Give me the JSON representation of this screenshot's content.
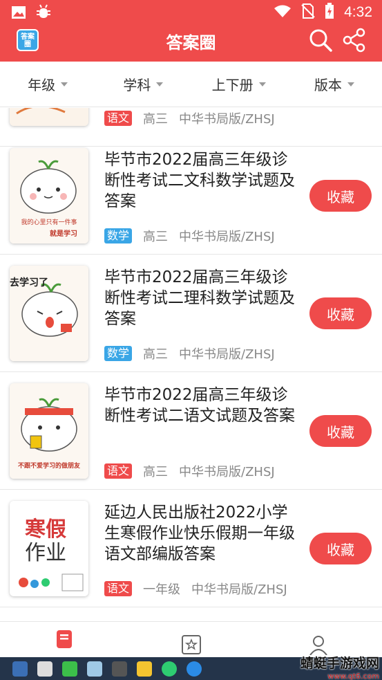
{
  "status_bar": {
    "time": "4:32"
  },
  "header": {
    "title": "答案圈",
    "logo_text": "答案圈"
  },
  "filters": [
    {
      "label": "年级"
    },
    {
      "label": "学科"
    },
    {
      "label": "上下册"
    },
    {
      "label": "版本"
    }
  ],
  "list": {
    "partial_top": {
      "tag": "语文",
      "grade": "高三",
      "publisher": "中华书局版/ZHSJ"
    },
    "items": [
      {
        "title": "毕节市2022届高三年级诊断性考试二文科数学试题及答案",
        "tag": "数学",
        "grade": "高三",
        "publisher": "中华书局版/ZHSJ",
        "button": "收藏",
        "thumb_text_top": "我的心里只有一件事",
        "thumb_text_bottom": "就是学习"
      },
      {
        "title": "毕节市2022届高三年级诊断性考试二理科数学试题及答案",
        "tag": "数学",
        "grade": "高三",
        "publisher": "中华书局版/ZHSJ",
        "button": "收藏",
        "thumb_text_top": "去学习了",
        "thumb_text_bottom": ""
      },
      {
        "title": "毕节市2022届高三年级诊断性考试二语文试题及答案",
        "tag": "语文",
        "grade": "高三",
        "publisher": "中华书局版/ZHSJ",
        "button": "收藏",
        "thumb_text_top": "",
        "thumb_text_bottom": "不跟不爱学习的做朋友"
      },
      {
        "title": "延边人民出版社2022小学生寒假作业快乐假期一年级语文部编版答案",
        "tag": "语文",
        "grade": "一年级",
        "publisher": "中华书局版/ZHSJ",
        "button": "收藏",
        "thumb_text_top": "寒假",
        "thumb_text_bottom": "作业"
      }
    ]
  },
  "watermark": {
    "title": "蜻蜓手游戏网",
    "url": "www.qt6.com"
  },
  "colors": {
    "brand_red": "#ef4b4b",
    "math_tag": "#3aa6e6",
    "chinese_tag": "#ef4b4b"
  }
}
